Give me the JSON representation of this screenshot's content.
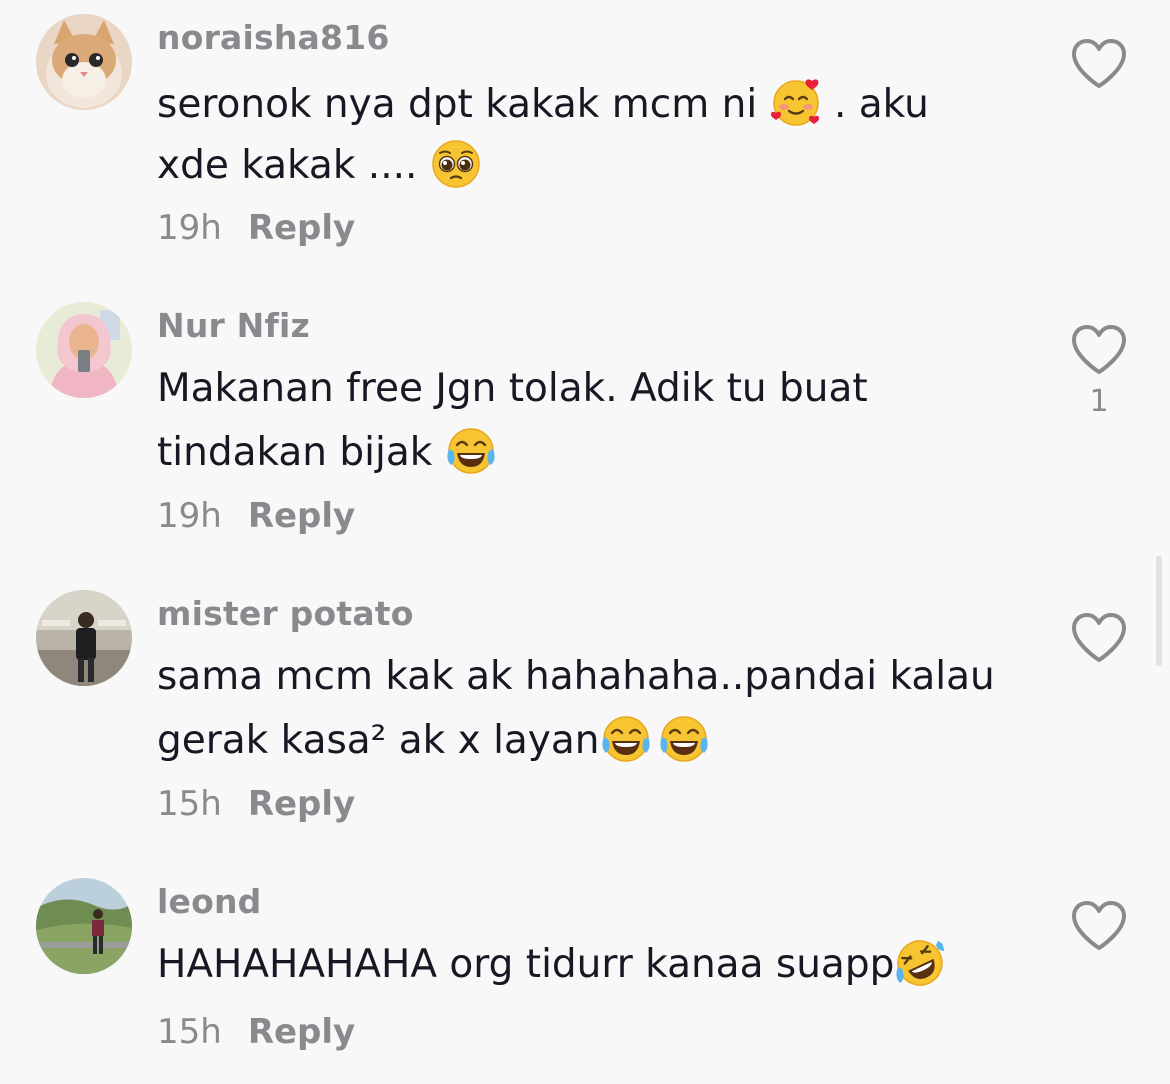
{
  "comments": [
    {
      "username": "noraisha816",
      "lines": [
        "seronok nya dpt kakak mcm ni",
        ". aku",
        "xde kakak ...."
      ],
      "time": "19h",
      "reply_label": "Reply",
      "likes": "",
      "emojis": [
        "smiling-face-with-hearts",
        "pleading-face"
      ]
    },
    {
      "username": "Nur Nfiz",
      "lines": [
        "Makanan free Jgn tolak. Adik tu buat",
        "tindakan bijak"
      ],
      "time": "19h",
      "reply_label": "Reply",
      "likes": "1",
      "emojis": [
        "face-with-tears-of-joy"
      ]
    },
    {
      "username": "mister potato",
      "lines": [
        "sama mcm kak ak hahahaha..pandai kalau",
        "gerak kasa² ak x layan"
      ],
      "time": "15h",
      "reply_label": "Reply",
      "likes": "",
      "emojis": [
        "face-with-tears-of-joy",
        "face-with-tears-of-joy"
      ]
    },
    {
      "username": "leond",
      "lines": [
        "HAHAHAHAHA org tidurr kanaa suapp"
      ],
      "time": "15h",
      "reply_label": "Reply",
      "likes": "",
      "emojis": [
        "rolling-on-the-floor-laughing"
      ]
    }
  ],
  "colors": {
    "background": "#f8f8f8",
    "text": "#161823",
    "secondary": "#8a8a8e",
    "icon": "#8a8a8e"
  }
}
